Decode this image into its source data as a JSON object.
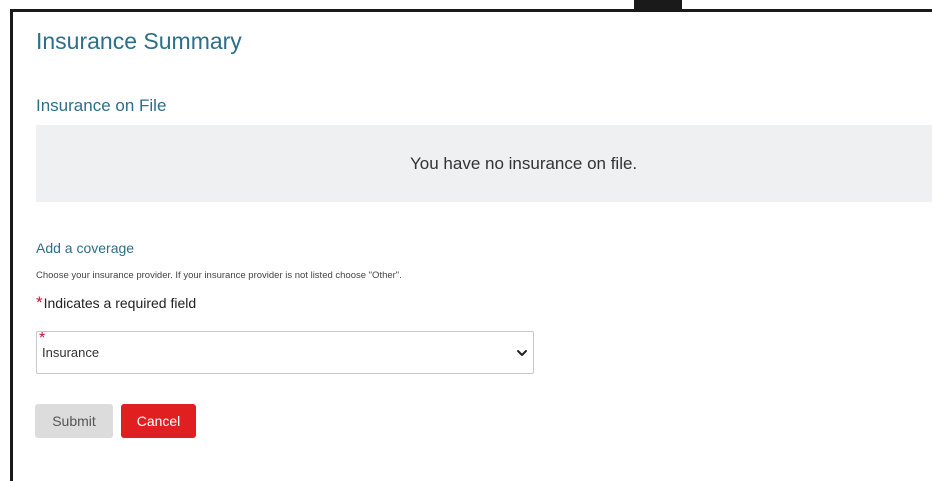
{
  "page": {
    "title": "Insurance Summary"
  },
  "insurance_on_file": {
    "heading": "Insurance on File",
    "empty_message": "You have no insurance on file."
  },
  "add_coverage": {
    "link_label": "Add a coverage",
    "hint": "Choose your insurance provider. If your insurance provider is not listed choose \"Other\".",
    "required_star": "*",
    "required_note": "Indicates a required field"
  },
  "insurance_select": {
    "required_star": "*",
    "selected_value": "Insurance"
  },
  "actions": {
    "submit_label": "Submit",
    "cancel_label": "Cancel"
  },
  "colors": {
    "heading": "#2b6f8a",
    "panel_background": "#eef0f1",
    "required": "#c8102e",
    "submit_background": "#dcdcdc",
    "cancel_background": "#e02020"
  },
  "icons": {
    "select_arrow": "chevron-down-icon"
  }
}
